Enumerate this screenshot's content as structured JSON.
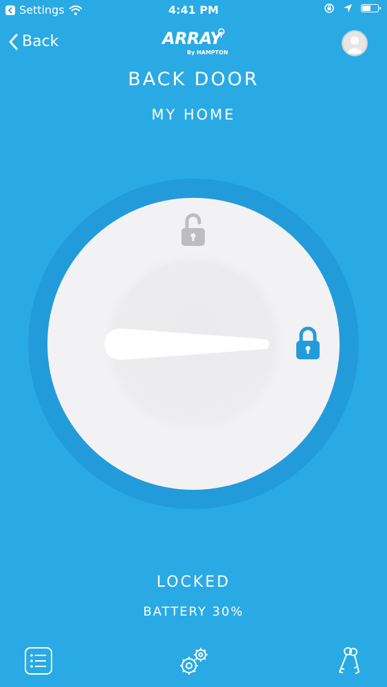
{
  "status_bar": {
    "back_app": "Settings",
    "time": "4:41 PM",
    "battery_level": 0.5
  },
  "nav": {
    "back_label": "Back",
    "logo_main": "ARRAY",
    "logo_sub": "By HAMPTON"
  },
  "lock": {
    "name": "BACK DOOR",
    "location": "MY HOME",
    "state": "LOCKED",
    "battery": "BATTERY 30%"
  },
  "icons": {
    "back": "chevron-left-icon",
    "avatar": "user-avatar-icon",
    "unlocked": "unlocked-padlock-icon",
    "locked": "locked-padlock-icon",
    "list": "list-icon",
    "settings": "gears-icon",
    "keys": "keys-icon"
  },
  "colors": {
    "background": "#2AAAE4",
    "dial_ring": "#229BDA",
    "dial_face": "#F2F2F4",
    "unlocked_icon": "#BDBDBD",
    "locked_icon": "#229BDA",
    "text": "#FFFFFF"
  }
}
